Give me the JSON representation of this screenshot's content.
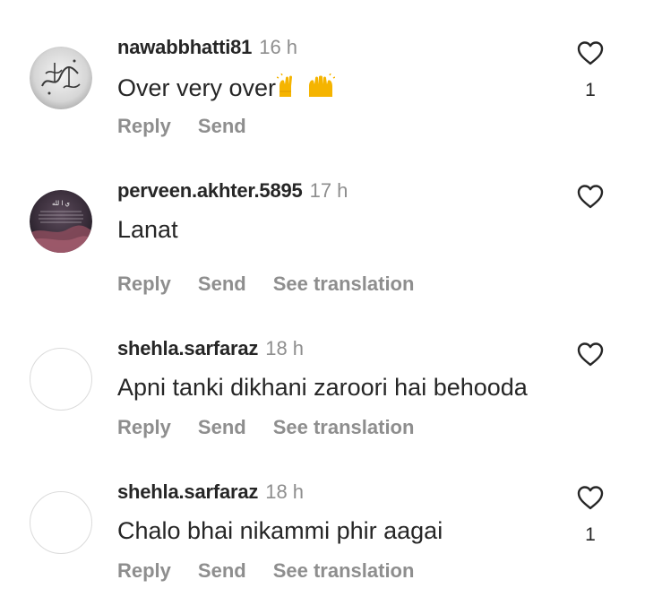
{
  "comments": [
    {
      "username": "nawabbhatti81",
      "time": "16 h",
      "text": "Over very over",
      "emoji": "raising-hands-emoji x2",
      "reply": "Reply",
      "send": "Send",
      "likes": "1",
      "avatar": "calligraphy-avatar"
    },
    {
      "username": "perveen.akhter.5895",
      "time": "17 h",
      "text": "Lanat",
      "reply": "Reply",
      "send": "Send",
      "see_translation": "See translation",
      "avatar": "dark-photo-avatar"
    },
    {
      "username": "shehla.sarfaraz",
      "time": "18 h",
      "text": "Apni tanki dikhani zaroori hai behooda",
      "reply": "Reply",
      "send": "Send",
      "see_translation": "See translation",
      "avatar": "blank-avatar"
    },
    {
      "username": "shehla.sarfaraz",
      "time": "18 h",
      "text": "Chalo bhai nikammi phir aagai",
      "reply": "Reply",
      "send": "Send",
      "see_translation": "See translation",
      "likes": "1",
      "avatar": "blank-avatar"
    }
  ],
  "colors": {
    "text": "#262626",
    "secondary": "#8e8e8e",
    "avatar_border": "#dbdbdb",
    "emoji": "#f5b400"
  }
}
